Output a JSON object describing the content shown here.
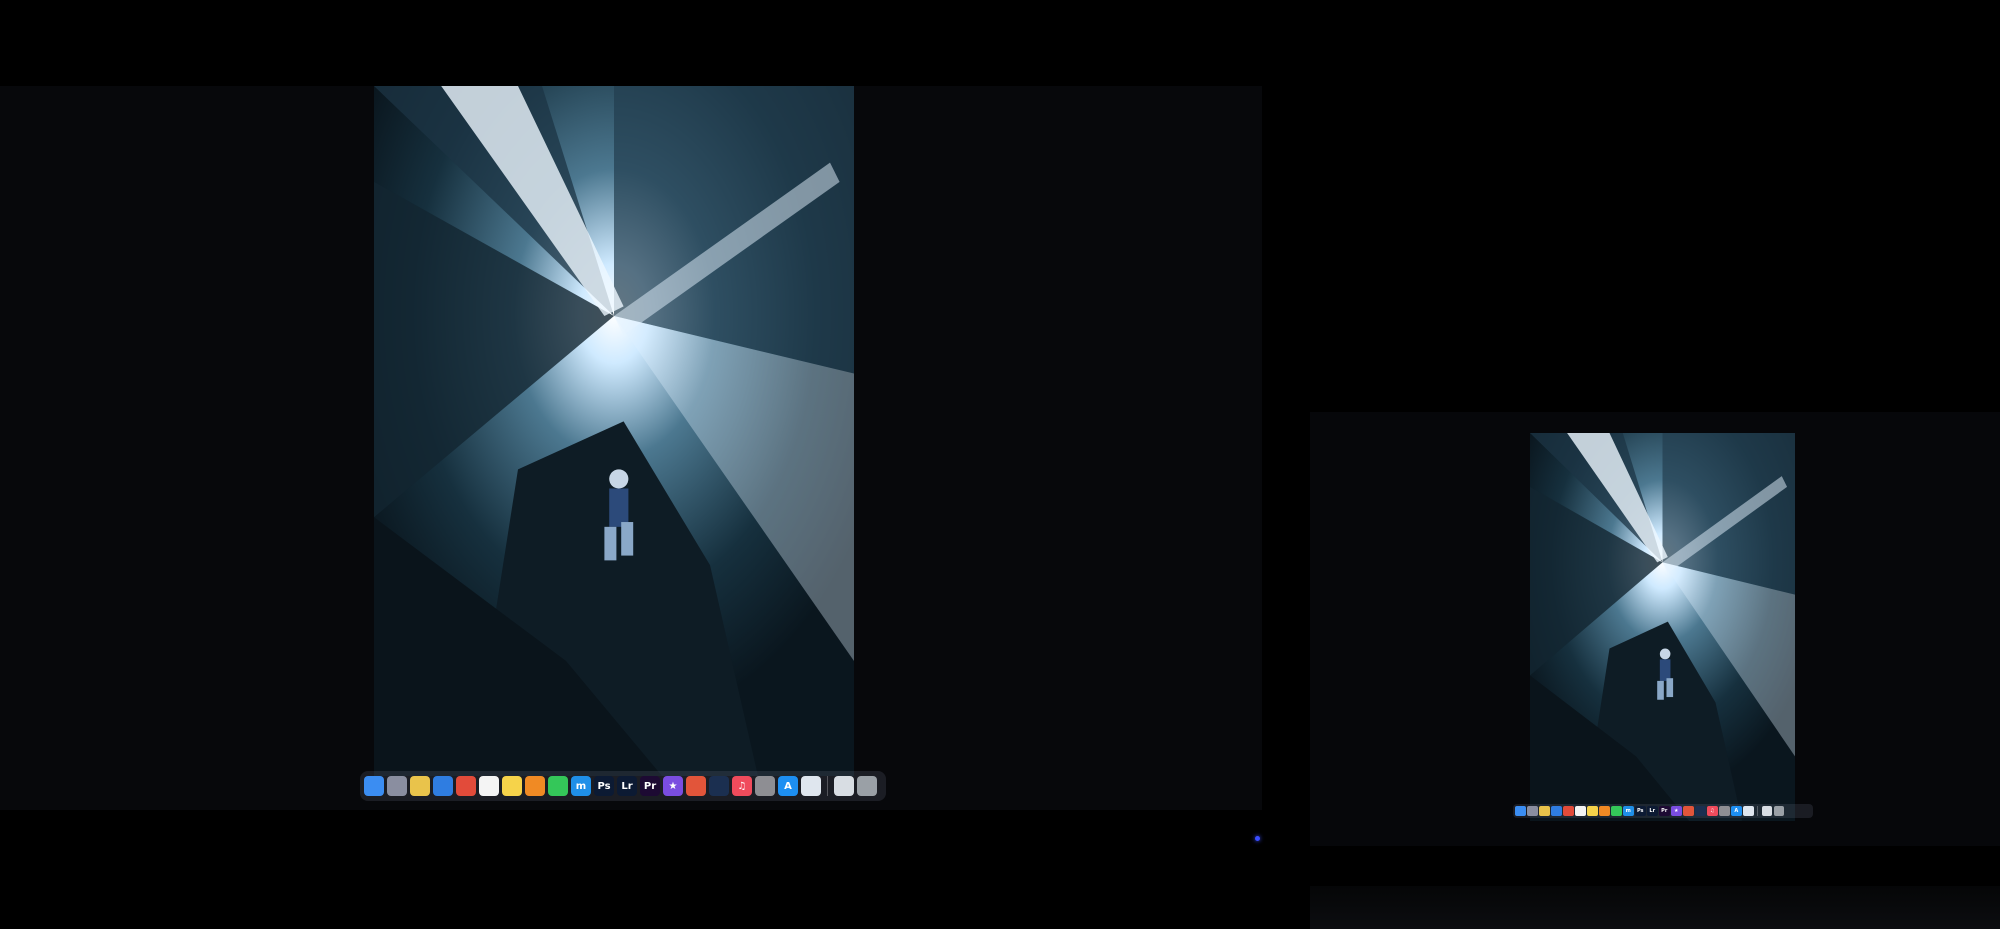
{
  "scene": {
    "large_display": "studio-display",
    "small_display": "laptop-display"
  },
  "wallpaper": {
    "subject": "city-canyon-climber-photo",
    "colors": {
      "sky": "#eaf6ff",
      "glow": "#9fd0f0",
      "building": "#2e4a5c",
      "shadow": "#0b1820"
    }
  },
  "dock": {
    "apps": [
      {
        "name": "finder-icon",
        "label": "",
        "color": "#3b8df2"
      },
      {
        "name": "launchpad-icon",
        "label": "",
        "color": "#8a8ea0"
      },
      {
        "name": "photos-icon",
        "label": "",
        "color": "#e9c34b"
      },
      {
        "name": "safari-icon",
        "label": "",
        "color": "#2f7de1"
      },
      {
        "name": "chrome-icon",
        "label": "",
        "color": "#e24b3a"
      },
      {
        "name": "calendar-icon",
        "label": "",
        "color": "#f4f4f4"
      },
      {
        "name": "notes-icon",
        "label": "",
        "color": "#f6d34a"
      },
      {
        "name": "pages-icon",
        "label": "",
        "color": "#f08a24"
      },
      {
        "name": "messages-icon",
        "label": "",
        "color": "#34c759"
      },
      {
        "name": "mail-icon",
        "label": "m",
        "color": "#1f8fe8"
      },
      {
        "name": "photoshop-icon",
        "label": "Ps",
        "color": "#0c1a33"
      },
      {
        "name": "lightroom-icon",
        "label": "Lr",
        "color": "#0c1a33"
      },
      {
        "name": "premiere-icon",
        "label": "Pr",
        "color": "#1d0a33"
      },
      {
        "name": "imovie-icon",
        "label": "★",
        "color": "#7a4de0"
      },
      {
        "name": "davinci-icon",
        "label": "",
        "color": "#e2553a"
      },
      {
        "name": "quicktime-icon",
        "label": "",
        "color": "#1b2f50"
      },
      {
        "name": "music-icon",
        "label": "♫",
        "color": "#f04b5c"
      },
      {
        "name": "settings-icon",
        "label": "",
        "color": "#8e8e93"
      },
      {
        "name": "app-store-icon",
        "label": "A",
        "color": "#1d8ff2"
      },
      {
        "name": "preview-icon",
        "label": "",
        "color": "#dfe6ee"
      }
    ],
    "trailing": [
      {
        "name": "downloads-stack-icon",
        "label": "",
        "color": "#d8dde3"
      },
      {
        "name": "trash-icon",
        "label": "",
        "color": "#9aa0a6"
      }
    ]
  }
}
